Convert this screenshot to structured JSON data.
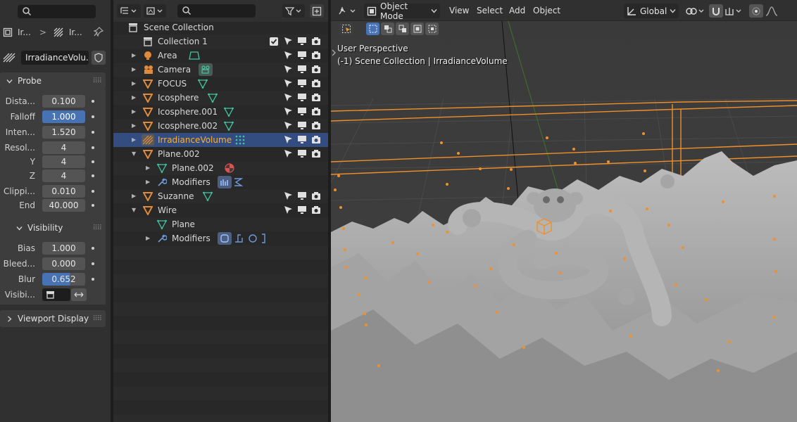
{
  "properties": {
    "breadcrumb": {
      "item1": "Ir...",
      "sep": ">",
      "item2": "Ir..."
    },
    "object_name": "IrradianceVolu...",
    "probe_panel": {
      "title": "Probe",
      "fields": [
        {
          "label": "Dista...",
          "value": "0.100"
        },
        {
          "label": "Falloff",
          "value": "1.000"
        },
        {
          "label": "Inten...",
          "value": "1.520"
        },
        {
          "label": "Resol...",
          "value": "4"
        },
        {
          "label": "Y",
          "value": "4"
        },
        {
          "label": "Z",
          "value": "4"
        },
        {
          "label": "Clippi...",
          "value": "0.010"
        },
        {
          "label": "End",
          "value": "40.000"
        }
      ]
    },
    "visibility_panel": {
      "title": "Visibility",
      "fields": [
        {
          "label": "Bias",
          "value": "1.000"
        },
        {
          "label": "Bleed...",
          "value": "0.000"
        },
        {
          "label": "Blur",
          "value": "0.652"
        }
      ],
      "visibility_label": "Visibi..."
    },
    "viewport_display_panel": {
      "title": "Viewport Display"
    }
  },
  "outliner": {
    "scene_collection": "Scene Collection",
    "rows": [
      {
        "name": "Collection 1"
      },
      {
        "name": "Area"
      },
      {
        "name": "Camera"
      },
      {
        "name": "FOCUS"
      },
      {
        "name": "Icosphere"
      },
      {
        "name": "Icosphere.001"
      },
      {
        "name": "Icosphere.002"
      },
      {
        "name": "IrradianceVolume"
      },
      {
        "name": "Plane.002"
      },
      {
        "name": "Plane.002"
      },
      {
        "name": "Modifiers"
      },
      {
        "name": "Suzanne"
      },
      {
        "name": "Wire"
      },
      {
        "name": "Plane"
      },
      {
        "name": "Modifiers"
      }
    ]
  },
  "viewport": {
    "mode": "Object Mode",
    "menus": {
      "view": "View",
      "select": "Select",
      "add": "Add",
      "object": "Object"
    },
    "transform_orientation": "Global",
    "overlay_line1": "User Perspective",
    "overlay_line2": "(-1) Scene Collection | IrradianceVolume"
  },
  "colors": {
    "selection": "#334d80",
    "selected_text": "#ffaf29",
    "field_blue": "#4772b3",
    "object_orange": "#e08a3a",
    "mesh_green": "#3fc9a0"
  }
}
